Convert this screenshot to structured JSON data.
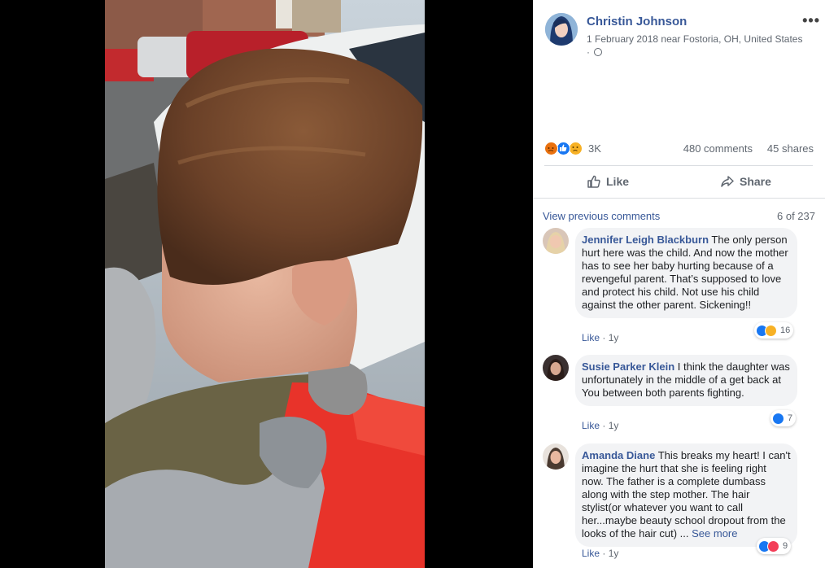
{
  "post": {
    "author": "Christin Johnson",
    "date_location": "1 February 2018 near Fostoria, OH, United States",
    "privacy_sep": "·",
    "more_label": "•••"
  },
  "reactions": {
    "icons": [
      "angry-icon",
      "like-icon",
      "sad-icon"
    ],
    "count": "3K",
    "comments": "480 comments",
    "shares": "45 shares"
  },
  "actions": {
    "like": "Like",
    "share": "Share"
  },
  "comments_section": {
    "view_previous": "View previous comments",
    "pager": "6 of 237",
    "items": [
      {
        "name": "Jennifer Leigh Blackburn",
        "text": " The only person hurt here was the child. And now the mother has to see her baby hurting because of a revengeful parent. That’s supposed to love and protect his child. Not use his child against the other parent. Sickening!!",
        "like": "Like",
        "sep": " · ",
        "time": "1y",
        "reaction_icons": [
          "like-icon",
          "haha-icon"
        ],
        "reaction_count": "16"
      },
      {
        "name": "Susie Parker Klein",
        "text": " I think the daughter was unfortunately in the middle of a get back at You between both parents fighting.",
        "like": "Like",
        "sep": " · ",
        "time": "1y",
        "reaction_icons": [
          "like-icon"
        ],
        "reaction_count": "7"
      },
      {
        "name": "Amanda Diane",
        "text": " This breaks my heart! I can't imagine the hurt that she is feeling right now. The father is a complete dumbass along with the step mother. The hair stylist(or whatever you want to call her...maybe beauty school dropout from the looks of the hair cut) ... ",
        "see_more": "See more",
        "like": "Like",
        "sep": " · ",
        "time": "1y",
        "reaction_icons": [
          "like-icon",
          "love-icon"
        ],
        "reaction_count": "9"
      }
    ]
  },
  "colors": {
    "link": "#385898",
    "meta": "#606770",
    "bubble": "#f2f3f5",
    "like_blue": "#1877f2",
    "angry": "#e9710f",
    "sad": "#f7b125",
    "love": "#f33e58",
    "jacket_red": "#e8332a"
  }
}
